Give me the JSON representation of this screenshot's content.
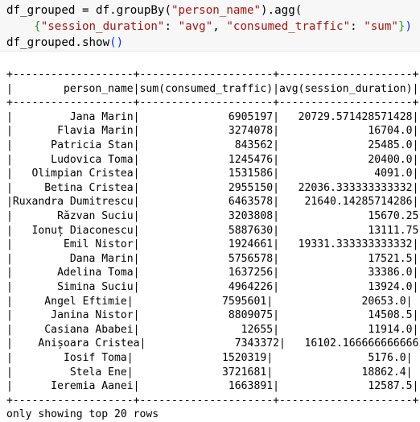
{
  "code": {
    "line1": {
      "prefix": "df_grouped = df.groupBy(",
      "arg": "\"person_name\"",
      "suffix": ").agg("
    },
    "line2": {
      "indent": "    ",
      "open_brace": "{",
      "key1": "\"session_duration\"",
      "colon1": ": ",
      "val1": "\"avg\"",
      "comma": ", ",
      "key2": "\"consumed_traffic\"",
      "colon2": ": ",
      "val2": "\"sum\"",
      "close_brace": "}",
      "close_paren": ")"
    },
    "line3": {
      "text": "df_grouped.show",
      "parens": "()"
    }
  },
  "output": {
    "border": "+-------------------+---------------------+---------------------+",
    "header": "|        person_name|sum(consumed_traffic)|avg(session_duration)|",
    "rows": [
      "|         Jana Marin|              6905197|   20729.571428571428|",
      "|       Flavia Marin|              3274078|              16704.0|",
      "|      Patricia Stan|               843562|              25485.0|",
      "|      Ludovica Toma|              1245476|              20400.0|",
      "|   Olimpian Cristea|              1531586|               4091.0|",
      "|     Betina Cristea|              2955150|   22036.333333333332|",
      "|Ruxandra Dumitrescu|              6463578|    21640.14285714286|",
      "|       Răzvan Suciu|              3203808|              15670.25|",
      "|   Ionuț Diaconescu|              5887630|              13111.75|",
      "|        Emil Nistor|              1924661|   19331.333333333332|",
      "|         Dana Marin|              5756578|              17521.5|",
      "|       Adelina Toma|              1637256|              33386.0|",
      "|       Simina Suciu|              4964226|              13924.0|",
      "|     Angel Eftimie|              7595601|              20653.0|",
      "|      Janina Nistor|              8809075|              14508.5|",
      "|     Casiana Ababei|                12655|              11914.0|",
      "|    Anișoara Cristea|              7343372|   16102.166666666666|",
      "|        Iosif Toma|              1520319|               5176.0|",
      "|         Stela Ene|              3721681|              18862.4|",
      "|      Ieremia Aanei|              1663891|              12587.5|"
    ],
    "footer": "only showing top 20 rows"
  },
  "colors": {
    "string": "#a31515",
    "punctuation": "#0431fa",
    "brace": "#319331",
    "cell_background": "#f7f7f7"
  }
}
